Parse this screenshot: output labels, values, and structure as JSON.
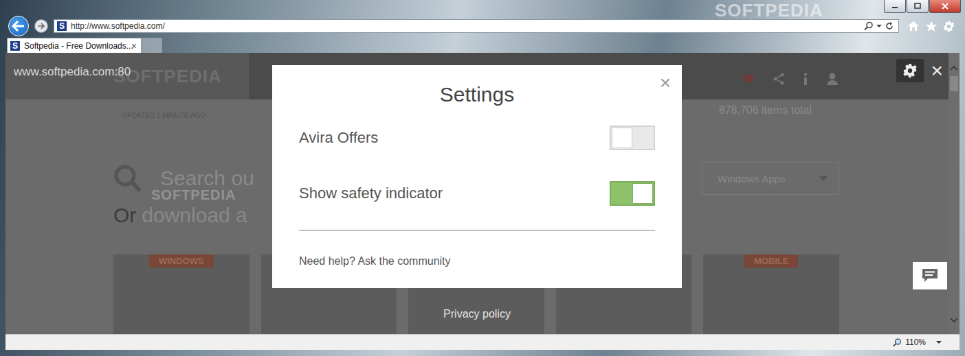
{
  "window": {
    "watermark": "SOFTPEDIA"
  },
  "address_bar": {
    "favicon": "S",
    "url": "http://www.softpedia.com/"
  },
  "tabs": [
    {
      "favicon": "S",
      "label": "Softpedia - Free Downloads...",
      "close": "×",
      "selected": true
    }
  ],
  "page": {
    "logo": "SOFTPEDIA",
    "updated": "UPDATED 1 MINUTE AGO",
    "items_total": "878,706 items total",
    "search": "Search ou",
    "download_lead": "Or",
    "download_rest": "download a",
    "dropdown": "Windows Apps",
    "cards": [
      {
        "tag": "WINDOWS"
      },
      {
        "tag": ""
      },
      {
        "tag": ""
      },
      {
        "tag": ""
      },
      {
        "tag": "MOBILE"
      }
    ],
    "watermark": "SOFTPEDIA"
  },
  "extension_bar": {
    "host": "www.softpedia.com:80",
    "close": "×"
  },
  "settings": {
    "title": "Settings",
    "close": "×",
    "options": [
      {
        "label": "Avira Offers",
        "on": false
      },
      {
        "label": "Show safety indicator",
        "on": true
      }
    ],
    "help": "Need help? Ask the community"
  },
  "privacy": "Privacy policy",
  "status_bar": {
    "zoom": "110%"
  }
}
